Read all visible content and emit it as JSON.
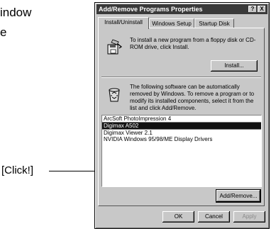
{
  "document": {
    "line1": "indow",
    "line2": "e",
    "click_label": "[Click!]"
  },
  "dialog": {
    "title": "Add/Remove Programs Properties",
    "help_glyph": "?",
    "close_glyph": "X",
    "tabs": [
      {
        "label": "Install/Uninstall"
      },
      {
        "label": "Windows Setup"
      },
      {
        "label": "Startup Disk"
      }
    ],
    "install_text": "To install a new program from a floppy disk or CD-ROM drive, click Install.",
    "install_button": "Install...",
    "remove_text": "The following software can be automatically removed by Windows. To remove a program or to modify its installed components, select it from the list and click Add/Remove.",
    "programs": [
      {
        "name": "ArcSoft PhotoImpression 4"
      },
      {
        "name": "Digimax A502"
      },
      {
        "name": "Digimax Viewer 2.1"
      },
      {
        "name": "NVIDIA Windows 95/98/ME Display Drivers"
      }
    ],
    "selected_program": "Digimax A502",
    "addremove_button": "Add/Remove...",
    "ok_button": "OK",
    "cancel_button": "Cancel",
    "apply_button": "Apply"
  },
  "icons": {
    "floppy": "floppy-install-icon",
    "recycle": "recycle-bin-icon"
  }
}
